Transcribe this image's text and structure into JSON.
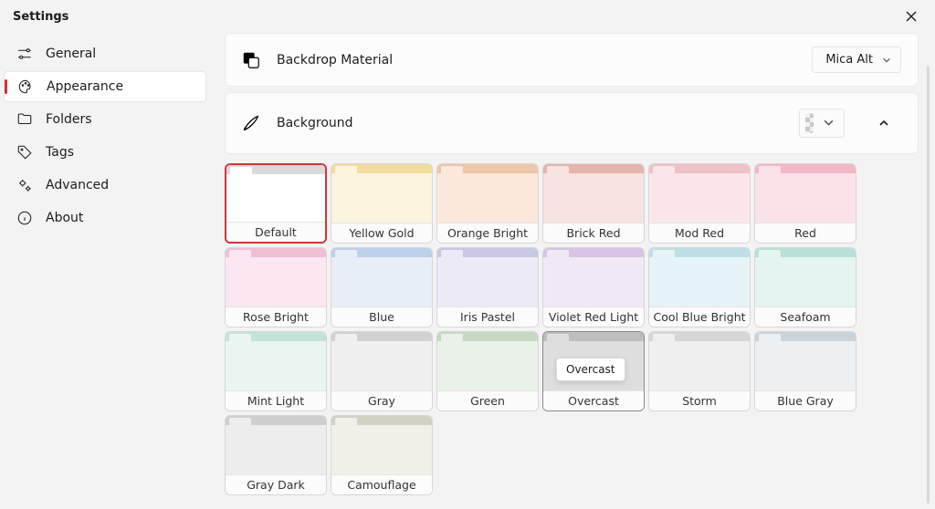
{
  "window": {
    "title": "Settings"
  },
  "nav": {
    "items": [
      {
        "id": "general",
        "label": "General"
      },
      {
        "id": "appearance",
        "label": "Appearance"
      },
      {
        "id": "folders",
        "label": "Folders"
      },
      {
        "id": "tags",
        "label": "Tags"
      },
      {
        "id": "advanced",
        "label": "Advanced"
      },
      {
        "id": "about",
        "label": "About"
      }
    ],
    "selected": "appearance"
  },
  "backdrop_row": {
    "title": "Backdrop Material",
    "value": "Mica Alt"
  },
  "background_row": {
    "title": "Background"
  },
  "tooltip": {
    "text": "Overcast"
  },
  "themes": [
    {
      "label": "Default",
      "top": "#d9d9d9",
      "body": "#ffffff",
      "selected": true
    },
    {
      "label": "Yellow Gold",
      "top": "#f3dca0",
      "body": "#fdf4de"
    },
    {
      "label": "Orange Bright",
      "top": "#f0c6a9",
      "body": "#fbe8db"
    },
    {
      "label": "Brick Red",
      "top": "#e4b4ad",
      "body": "#f6e2de"
    },
    {
      "label": "Mod Red",
      "top": "#eec1c6",
      "body": "#fae6e9"
    },
    {
      "label": "Red",
      "top": "#f1b8c6",
      "body": "#fbe2e9"
    },
    {
      "label": "Rose Bright",
      "top": "#f0bed3",
      "body": "#fce6ef"
    },
    {
      "label": "Blue",
      "top": "#bcd0ea",
      "body": "#e7eef8"
    },
    {
      "label": "Iris Pastel",
      "top": "#c8c7e4",
      "body": "#eceaf6"
    },
    {
      "label": "Violet Red Light",
      "top": "#d7c3e4",
      "body": "#f1e8f6"
    },
    {
      "label": "Cool Blue Bright",
      "top": "#bedfe6",
      "body": "#e7f4f7"
    },
    {
      "label": "Seafoam",
      "top": "#b8e0d8",
      "body": "#e4f4f0"
    },
    {
      "label": "Mint Light",
      "top": "#c2e4d7",
      "body": "#e9f5f0"
    },
    {
      "label": "Gray",
      "top": "#d1d1d1",
      "body": "#f0f0f0"
    },
    {
      "label": "Green",
      "top": "#c5d9c2",
      "body": "#eaf1e8"
    },
    {
      "label": "Overcast",
      "top": "#bdbdbd",
      "body": "#dedede",
      "hovered": true
    },
    {
      "label": "Storm",
      "top": "#d6d6d6",
      "body": "#efefef"
    },
    {
      "label": "Blue Gray",
      "top": "#c9d3da",
      "body": "#ecf0f3"
    },
    {
      "label": "Gray Dark",
      "top": "#cfcfcf",
      "body": "#ededed"
    },
    {
      "label": "Camouflage",
      "top": "#d3d1c3",
      "body": "#f0efe8"
    }
  ]
}
